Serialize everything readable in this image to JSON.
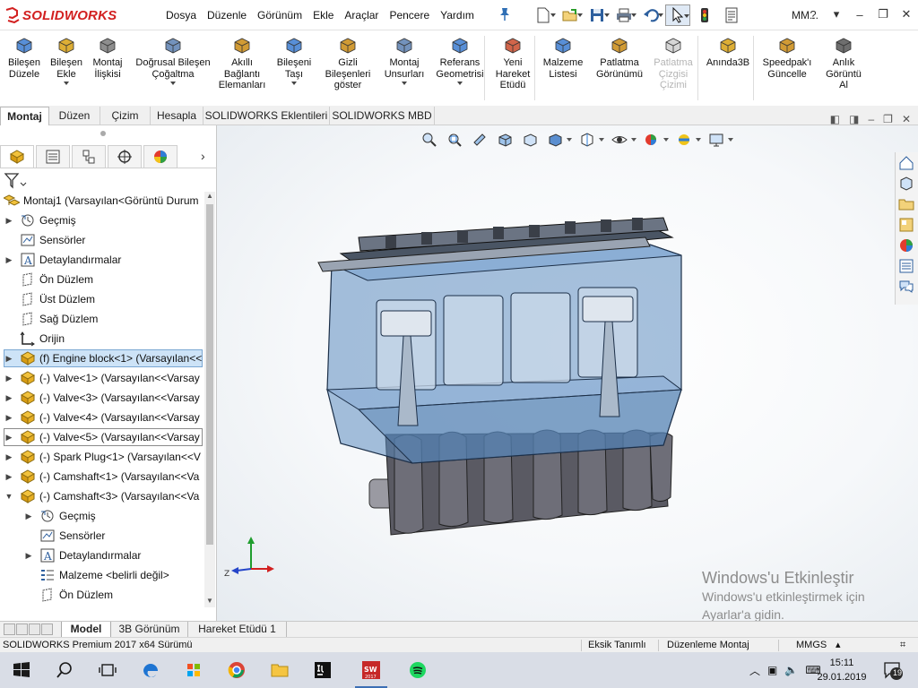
{
  "app": {
    "logo_text": "SOLIDWORKS",
    "brand_color": "#d22020"
  },
  "menu": [
    "Dosya",
    "Düzenle",
    "Görünüm",
    "Ekle",
    "Araçlar",
    "Pencere",
    "Yardım"
  ],
  "quick_user": "MM...",
  "ribbon": [
    {
      "lines": [
        "Bileşen",
        "Düzele"
      ]
    },
    {
      "lines": [
        "Bileşen",
        "Ekle"
      ],
      "dropdown": true
    },
    {
      "lines": [
        "Montaj",
        "İlişkisi"
      ]
    },
    {
      "lines": [
        "Doğrusal Bileşen",
        "Çoğaltma"
      ],
      "dropdown": true
    },
    {
      "lines": [
        "Akıllı",
        "Bağlantı",
        "Elemanları"
      ]
    },
    {
      "lines": [
        "Bileşeni",
        "Taşı"
      ],
      "dropdown": true
    },
    {
      "lines": [
        "Gizli",
        "Bileşenleri",
        "göster"
      ]
    },
    {
      "lines": [
        "Montaj",
        "Unsurları"
      ],
      "dropdown": true
    },
    {
      "lines": [
        "Referans",
        "Geometrisi"
      ],
      "dropdown": true
    },
    {
      "lines": [
        "Yeni",
        "Hareket",
        "Etüdü"
      ]
    },
    {
      "lines": [
        "Malzeme",
        "Listesi"
      ]
    },
    {
      "lines": [
        "Patlatma",
        "Görünümü"
      ]
    },
    {
      "lines": [
        "Patlatma",
        "Çizgisi",
        "Çizimi"
      ],
      "disabled": true
    },
    {
      "lines": [
        "Anında3B"
      ]
    },
    {
      "lines": [
        "Speedpak'ı",
        "Güncelle"
      ]
    },
    {
      "lines": [
        "Anlık",
        "Görüntü",
        "Al"
      ]
    }
  ],
  "cm_tabs": [
    "Montaj",
    "Düzen",
    "Çizim",
    "Hesapla",
    "SOLIDWORKS Eklentileri",
    "SOLIDWORKS MBD"
  ],
  "tree": {
    "root": "Montaj1  (Varsayılan<Görüntü Durum",
    "items": [
      {
        "label": "Geçmiş",
        "icon": "history-icon",
        "arrow": "right"
      },
      {
        "label": "Sensörler",
        "icon": "sensor-icon",
        "arrow": ""
      },
      {
        "label": "Detaylandırmalar",
        "icon": "annotation-icon",
        "arrow": "right"
      },
      {
        "label": "Ön Düzlem",
        "icon": "plane-icon",
        "arrow": ""
      },
      {
        "label": "Üst Düzlem",
        "icon": "plane-icon",
        "arrow": ""
      },
      {
        "label": "Sağ Düzlem",
        "icon": "plane-icon",
        "arrow": ""
      },
      {
        "label": "Orijin",
        "icon": "origin-icon",
        "arrow": ""
      },
      {
        "label": "(f) Engine block<1>  (Varsayılan<<",
        "icon": "part-icon",
        "arrow": "right",
        "state": "selected"
      },
      {
        "label": "(-) Valve<1>  (Varsayılan<<Varsay",
        "icon": "part-icon",
        "arrow": "right"
      },
      {
        "label": "(-) Valve<3>  (Varsayılan<<Varsay",
        "icon": "part-icon",
        "arrow": "right"
      },
      {
        "label": "(-) Valve<4>  (Varsayılan<<Varsay",
        "icon": "part-icon",
        "arrow": "right"
      },
      {
        "label": "(-) Valve<5>  (Varsayılan<<Varsay",
        "icon": "part-icon",
        "arrow": "right",
        "state": "boxed"
      },
      {
        "label": "(-) Spark Plug<1>  (Varsayılan<<V",
        "icon": "part-icon",
        "arrow": "right"
      },
      {
        "label": "(-) Camshaft<1>  (Varsayılan<<Va",
        "icon": "part-icon",
        "arrow": "right"
      },
      {
        "label": "(-) Camshaft<3>  (Varsayılan<<Va",
        "icon": "part-icon",
        "arrow": "down"
      },
      {
        "label": "Geçmiş",
        "icon": "history-icon",
        "arrow": "right",
        "indent": 1
      },
      {
        "label": "Sensörler",
        "icon": "sensor-icon",
        "arrow": "",
        "indent": 1
      },
      {
        "label": "Detaylandırmalar",
        "icon": "annotation-icon",
        "arrow": "right",
        "indent": 1
      },
      {
        "label": "Malzeme <belirli değil>",
        "icon": "material-icon",
        "arrow": "",
        "indent": 1
      },
      {
        "label": "Ön Düzlem",
        "icon": "plane-icon",
        "arrow": "",
        "indent": 1
      }
    ]
  },
  "bottom_tabs": [
    "Model",
    "3B Görünüm",
    "Hareket Etüdü 1"
  ],
  "status": {
    "version": "SOLIDWORKS Premium 2017 x64 Sürümü",
    "definition": "Eksik Tanımlı",
    "mode": "Düzenleme Montaj",
    "units": "MMGS"
  },
  "watermark": {
    "title": "Windows'u Etkinleştir",
    "line1": "Windows'u etkinleştirmek için",
    "line2": "Ayarlar'a gidin."
  },
  "clock": {
    "time": "15:11",
    "date": "29.01.2019"
  },
  "notifications": "19"
}
